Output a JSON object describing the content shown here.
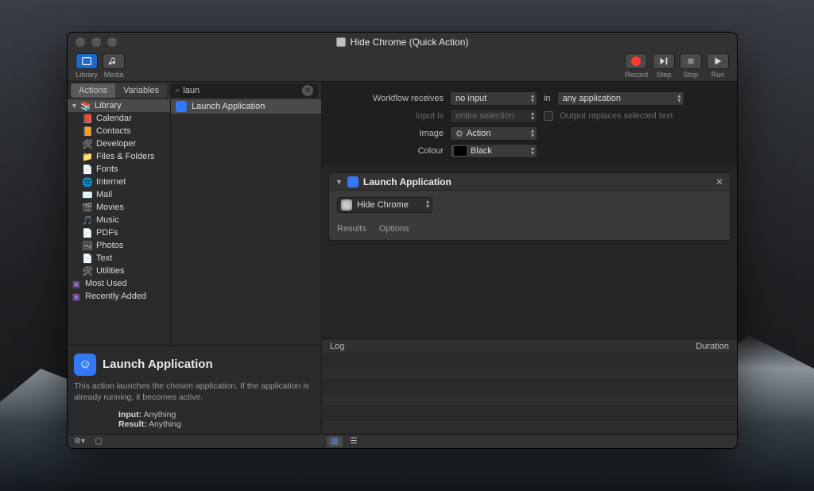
{
  "window": {
    "title": "Hide Chrome (Quick Action)"
  },
  "toolbar": {
    "library": "Library",
    "media": "Media",
    "record": "Record",
    "step": "Step",
    "stop": "Stop",
    "run": "Run"
  },
  "sidebar": {
    "tabs": {
      "actions": "Actions",
      "variables": "Variables"
    },
    "search_value": "laun",
    "library_root": "Library",
    "categories": [
      "Calendar",
      "Contacts",
      "Developer",
      "Files & Folders",
      "Fonts",
      "Internet",
      "Mail",
      "Movies",
      "Music",
      "PDFs",
      "Photos",
      "Text",
      "Utilities"
    ],
    "groups": {
      "most_used": "Most Used",
      "recently_added": "Recently Added"
    },
    "results": [
      "Launch Application"
    ]
  },
  "description": {
    "title": "Launch Application",
    "text": "This action launches the chosen application. If the application is already running, it becomes active.",
    "input_label": "Input:",
    "input_value": "Anything",
    "result_label": "Result:",
    "result_value": "Anything"
  },
  "settings": {
    "workflow_receives_label": "Workflow receives",
    "workflow_receives_value": "no input",
    "in_label": "in",
    "in_value": "any application",
    "input_is_label": "Input is",
    "input_is_value": "entire selection",
    "output_replaces_label": "Output replaces selected text",
    "image_label": "Image",
    "image_value": "Action",
    "colour_label": "Colour",
    "colour_value": "Black"
  },
  "workflow": {
    "action_title": "Launch Application",
    "selected_app": "Hide Chrome",
    "tabs": {
      "results": "Results",
      "options": "Options"
    }
  },
  "log": {
    "header_log": "Log",
    "header_duration": "Duration"
  }
}
